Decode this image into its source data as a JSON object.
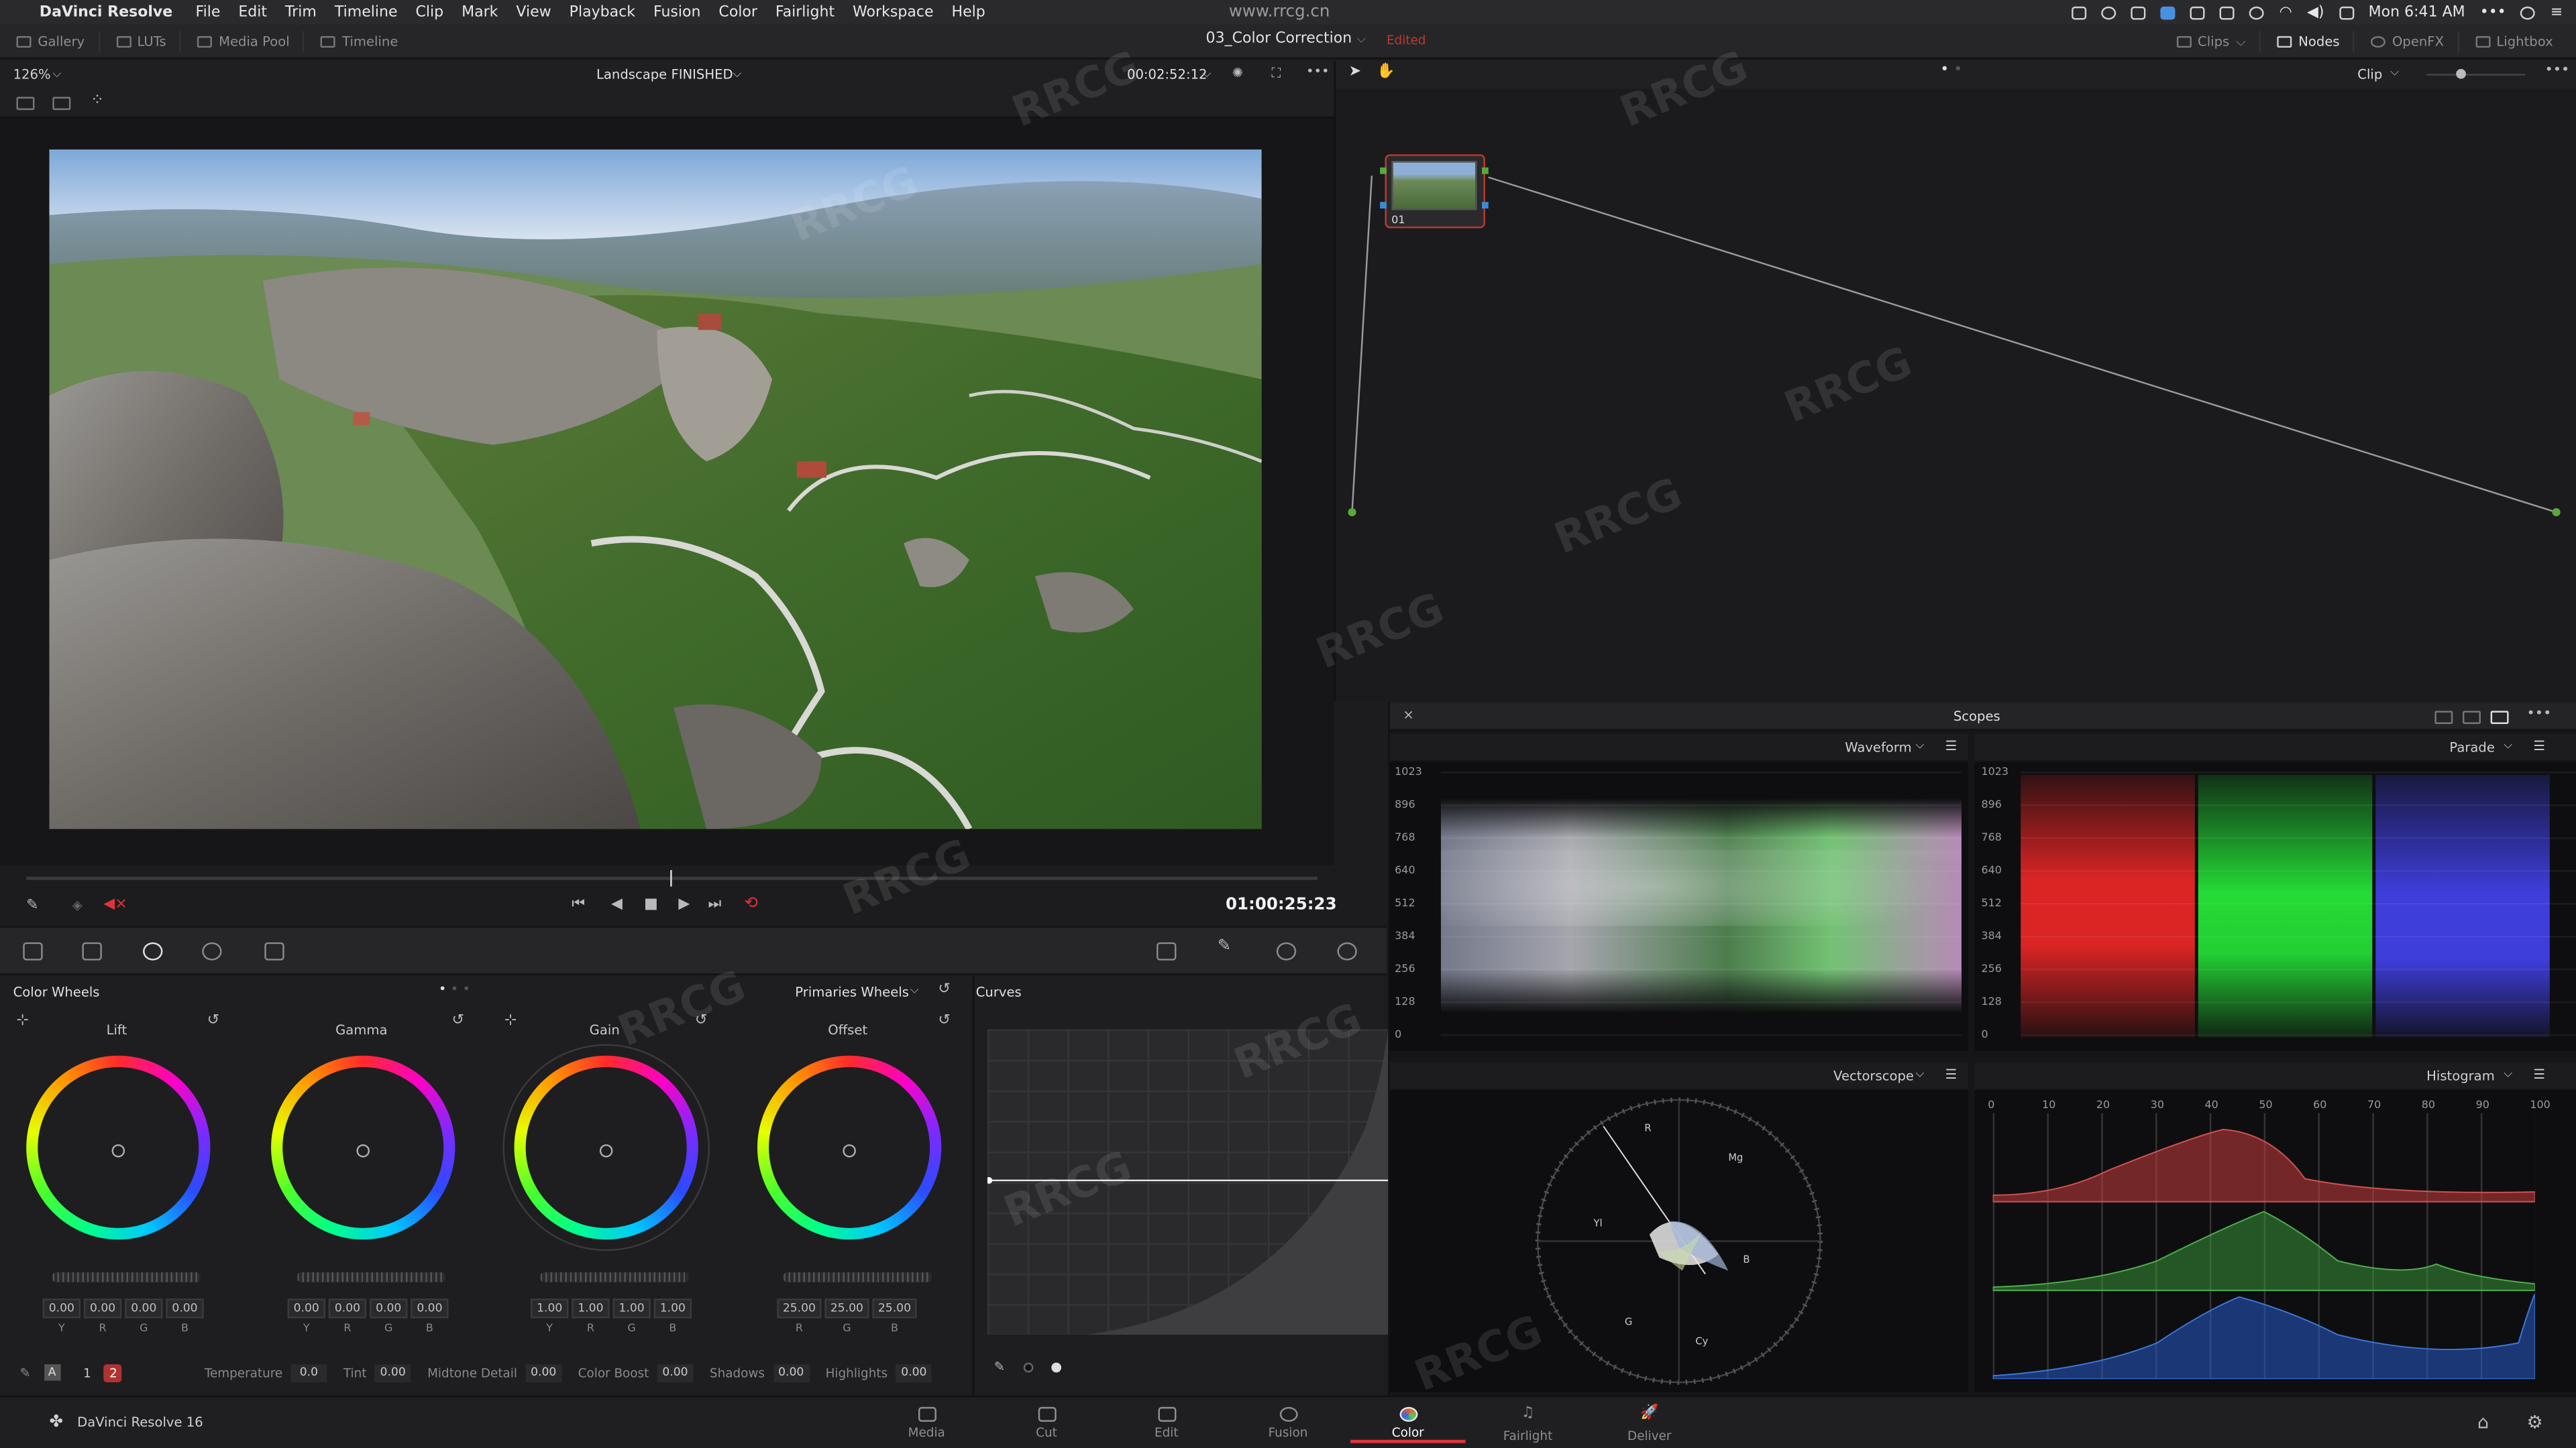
{
  "menubar": {
    "app_name": "DaVinci Resolve",
    "menus": [
      "File",
      "Edit",
      "Trim",
      "Timeline",
      "Clip",
      "Mark",
      "View",
      "Playback",
      "Fusion",
      "Color",
      "Fairlight",
      "Workspace",
      "Help"
    ],
    "clock": "Mon 6:41 AM",
    "watermark_url": "www.rrcg.cn"
  },
  "toolbar": {
    "gallery": "Gallery",
    "luts": "LUTs",
    "media_pool": "Media Pool",
    "timeline": "Timeline",
    "project_title": "03_Color Correction",
    "edited": "Edited",
    "clips": "Clips",
    "nodes": "Nodes",
    "openfx": "OpenFX",
    "lightbox": "Lightbox"
  },
  "viewer": {
    "zoom": "126%",
    "clip_name": "Landscape FINISHED",
    "source_tc": "00:02:52:12",
    "record_tc": "01:00:25:23",
    "playhead_fraction": 0.5
  },
  "node_editor": {
    "mode": "Clip",
    "node_label": "01"
  },
  "color_wheels": {
    "title": "Color Wheels",
    "mode": "Primaries Wheels",
    "wheels": [
      {
        "label": "Lift",
        "values": [
          "0.00",
          "0.00",
          "0.00",
          "0.00"
        ]
      },
      {
        "label": "Gamma",
        "values": [
          "0.00",
          "0.00",
          "0.00",
          "0.00"
        ]
      },
      {
        "label": "Gain",
        "values": [
          "1.00",
          "1.00",
          "1.00",
          "1.00"
        ]
      },
      {
        "label": "Offset",
        "values": [
          "25.00",
          "25.00",
          "25.00"
        ]
      }
    ],
    "channel_letters": [
      "Y",
      "R",
      "G",
      "B"
    ],
    "offset_letters": [
      "R",
      "G",
      "B"
    ]
  },
  "curves": {
    "title": "Curves"
  },
  "params": {
    "page_1": "1",
    "page_2": "2",
    "temperature_label": "Temperature",
    "temperature": "0.0",
    "tint_label": "Tint",
    "tint": "0.00",
    "midtone_label": "Midtone Detail",
    "midtone": "0.00",
    "boost_label": "Color Boost",
    "boost": "0.00",
    "shadows_label": "Shadows",
    "shadows": "0.00",
    "highlights_label": "Highlights",
    "highlights": "0.00"
  },
  "scopes": {
    "title": "Scopes",
    "waveform_label": "Waveform",
    "parade_label": "Parade",
    "vectorscope_label": "Vectorscope",
    "histogram_label": "Histogram",
    "y_ticks": [
      "1023",
      "896",
      "768",
      "640",
      "512",
      "384",
      "256",
      "128",
      "0"
    ],
    "hist_ticks": [
      "0",
      "10",
      "20",
      "30",
      "40",
      "50",
      "60",
      "70",
      "80",
      "90",
      "100"
    ],
    "vector_targets": [
      "R",
      "Mg",
      "B",
      "Cy",
      "G",
      "Yl"
    ]
  },
  "pages": {
    "brand": "DaVinci Resolve 16",
    "items": [
      "Media",
      "Cut",
      "Edit",
      "Fusion",
      "Color",
      "Fairlight",
      "Deliver"
    ],
    "active": "Color"
  },
  "colors": {
    "accent_red": "#e0343b",
    "background": "#1c1c1e",
    "edited": "#c0392b"
  }
}
